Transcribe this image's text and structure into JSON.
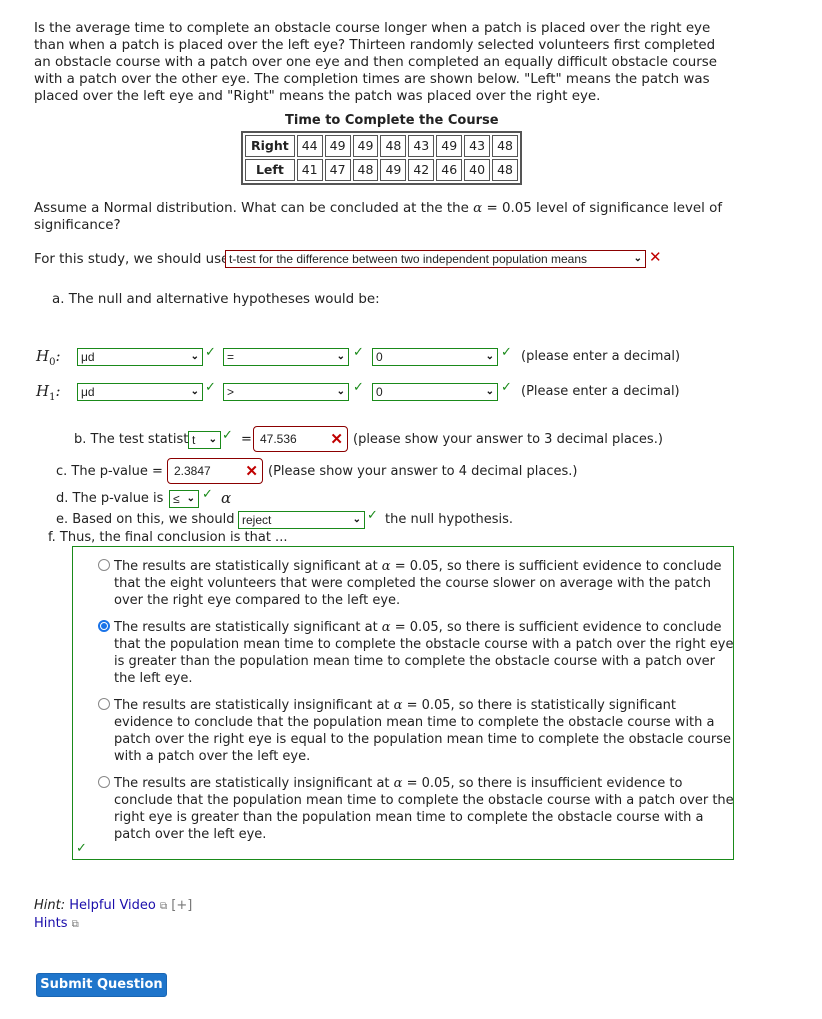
{
  "intro_text": "Is the average time to complete an obstacle course longer when a patch is placed over the right eye than when a patch is placed over the left eye? Thirteen randomly selected volunteers first completed an obstacle course with a patch over one eye and then completed an equally difficult obstacle course with a patch over the other eye. The completion times are shown below. \"Left\" means the patch was placed over the left eye and \"Right\" means the patch was placed over the right eye.",
  "table": {
    "title": "Time to Complete the Course",
    "rows": [
      {
        "label": "Right",
        "values": [
          "44",
          "49",
          "49",
          "48",
          "43",
          "49",
          "43",
          "48"
        ]
      },
      {
        "label": "Left",
        "values": [
          "41",
          "47",
          "48",
          "49",
          "42",
          "46",
          "40",
          "48"
        ]
      }
    ]
  },
  "assume_text_1": "Assume a Normal distribution.  What can be concluded at the the ",
  "alpha_symbol": "α",
  "assume_text_2": " = 0.05 level of significance level of significance?",
  "study": {
    "prefix": "For this study, we should use",
    "selected": "t-test for the difference between two independent population means",
    "status": "incorrect"
  },
  "part_a": {
    "label": "a. The null and alternative hypotheses would be:",
    "h0": {
      "label": "H",
      "sub": "0",
      "param": "μd",
      "op": "=",
      "value": "0",
      "note": "(please enter a decimal)"
    },
    "h1": {
      "label": "H",
      "sub": "1",
      "param": "μd",
      "op": ">",
      "value": "0",
      "note": "(Please enter a decimal)"
    }
  },
  "part_b": {
    "label": "b. The test statistic",
    "stat": "t",
    "equals": "=",
    "value": "47.536",
    "note": "(please show your answer to 3 decimal places.)"
  },
  "part_c": {
    "label": "c. The p-value =",
    "value": "2.3847",
    "note": "(Please show your answer to 4 decimal places.)"
  },
  "part_d": {
    "label": "d. The p-value is",
    "op": "≤",
    "alpha": "α"
  },
  "part_e": {
    "label": "e. Based on this, we should",
    "selected": "reject",
    "suffix": "the null hypothesis."
  },
  "part_f": {
    "label": "f. Thus, the final conclusion is that ...",
    "options": [
      {
        "pre": "The results are statistically significant at ",
        "post": " = 0.05, so there is sufficient evidence to conclude that the eight volunteers that were completed the course slower on average with the patch over the right eye compared to the left eye.",
        "selected": false
      },
      {
        "pre": "The results are statistically significant at ",
        "post": " = 0.05, so there is sufficient evidence to conclude that the population mean time to complete the obstacle course with a patch over the right eye is greater than the population mean time to complete the obstacle course with a patch over the left eye.",
        "selected": true
      },
      {
        "pre": "The results are statistically insignificant at ",
        "post": " = 0.05, so there is statistically significant evidence to conclude that the population mean time to complete the obstacle course with a patch over the right eye is equal to the population mean time to complete the obstacle course with a patch over the left eye.",
        "selected": false
      },
      {
        "pre": "The results are statistically insignificant at ",
        "post": " = 0.05, so there is insufficient evidence to conclude that the population mean time to complete the obstacle course with a patch over the right eye is greater than the population mean time to complete the obstacle course with a patch over the left eye.",
        "selected": false
      }
    ]
  },
  "hints": {
    "hint_label": "Hint:",
    "video_link": "Helpful Video",
    "expand": "[+]",
    "hints_link": "Hints"
  },
  "submit_label": "Submit Question",
  "icons": {
    "check": "✓",
    "cross": "✕",
    "chevron": "⌄",
    "external": "⧉"
  },
  "colors": {
    "correct": "#1a8a1a",
    "incorrect": "#8b0000",
    "button": "#1f75cb",
    "link": "#1a0dab"
  }
}
